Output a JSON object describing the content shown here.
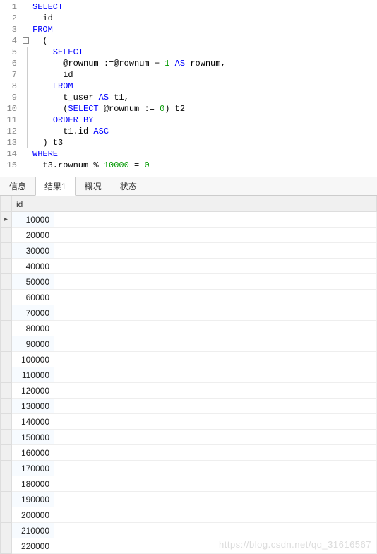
{
  "code": {
    "lines": [
      {
        "n": 1,
        "fold": "",
        "tokens": [
          [
            "kw",
            "SELECT"
          ]
        ]
      },
      {
        "n": 2,
        "fold": "",
        "tokens": [
          [
            "ident",
            "  id"
          ]
        ]
      },
      {
        "n": 3,
        "fold": "",
        "tokens": [
          [
            "kw",
            "FROM"
          ]
        ]
      },
      {
        "n": 4,
        "fold": "box",
        "tokens": [
          [
            "ident",
            "  ("
          ]
        ]
      },
      {
        "n": 5,
        "fold": "line",
        "tokens": [
          [
            "ident",
            "    "
          ],
          [
            "kw",
            "SELECT"
          ]
        ]
      },
      {
        "n": 6,
        "fold": "line",
        "tokens": [
          [
            "ident",
            "      @rownum :=@rownum + "
          ],
          [
            "num",
            "1"
          ],
          [
            "ident",
            " "
          ],
          [
            "kw",
            "AS"
          ],
          [
            "ident",
            " rownum,"
          ]
        ]
      },
      {
        "n": 7,
        "fold": "line",
        "tokens": [
          [
            "ident",
            "      id"
          ]
        ]
      },
      {
        "n": 8,
        "fold": "line",
        "tokens": [
          [
            "ident",
            "    "
          ],
          [
            "kw",
            "FROM"
          ]
        ]
      },
      {
        "n": 9,
        "fold": "line",
        "tokens": [
          [
            "ident",
            "      t_user "
          ],
          [
            "kw",
            "AS"
          ],
          [
            "ident",
            " t1,"
          ]
        ]
      },
      {
        "n": 10,
        "fold": "line",
        "tokens": [
          [
            "ident",
            "      ("
          ],
          [
            "kw",
            "SELECT"
          ],
          [
            "ident",
            " @rownum := "
          ],
          [
            "num",
            "0"
          ],
          [
            "ident",
            ") t2"
          ]
        ]
      },
      {
        "n": 11,
        "fold": "line",
        "tokens": [
          [
            "ident",
            "    "
          ],
          [
            "kw",
            "ORDER BY"
          ]
        ]
      },
      {
        "n": 12,
        "fold": "line",
        "tokens": [
          [
            "ident",
            "      t1.id "
          ],
          [
            "kw",
            "ASC"
          ]
        ]
      },
      {
        "n": 13,
        "fold": "end",
        "tokens": [
          [
            "ident",
            "  ) t3"
          ]
        ]
      },
      {
        "n": 14,
        "fold": "",
        "tokens": [
          [
            "kw",
            "WHERE"
          ]
        ]
      },
      {
        "n": 15,
        "fold": "",
        "tokens": [
          [
            "ident",
            "  t3.rownum % "
          ],
          [
            "num",
            "10000"
          ],
          [
            "ident",
            " = "
          ],
          [
            "num",
            "0"
          ]
        ]
      }
    ]
  },
  "tabs": {
    "items": [
      {
        "label": "信息",
        "active": false
      },
      {
        "label": "结果1",
        "active": true
      },
      {
        "label": "概况",
        "active": false
      },
      {
        "label": "状态",
        "active": false
      }
    ]
  },
  "result": {
    "column": "id",
    "current_row_index": 0,
    "rows": [
      10000,
      20000,
      30000,
      40000,
      50000,
      60000,
      70000,
      80000,
      90000,
      100000,
      110000,
      120000,
      130000,
      140000,
      150000,
      160000,
      170000,
      180000,
      190000,
      200000,
      210000,
      220000
    ]
  },
  "watermark": "https://blog.csdn.net/qq_31616567"
}
